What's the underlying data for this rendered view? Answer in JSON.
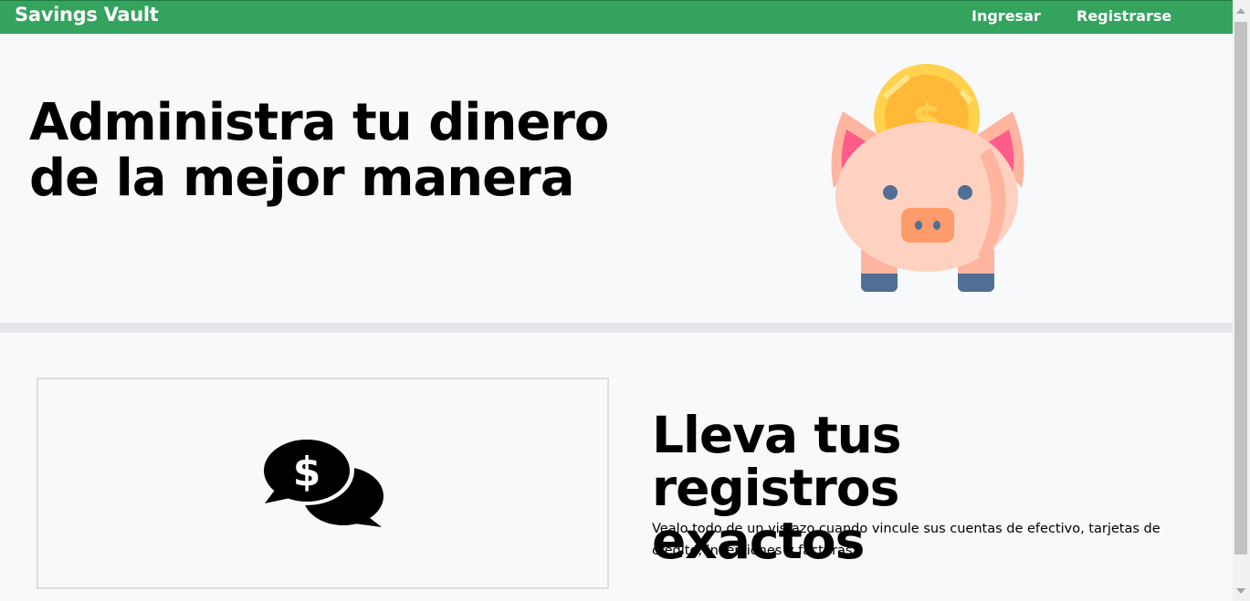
{
  "navbar": {
    "brand": "Savings Vault",
    "login": "Ingresar",
    "register": "Registrarse",
    "color": "#33a35d"
  },
  "hero": {
    "title_line1": "Administra tu dinero",
    "title_line2": "de la mejor manera",
    "image_icon": "piggy-bank-coin-icon"
  },
  "feature": {
    "icon": "chat-money-icon",
    "title_line1": "Lleva tus registros",
    "title_line2": "exactos",
    "description": "Vealo todo de un vistazo cuando vincule sus cuentas de efectivo, tarjetas de credito, inversiones y facturas"
  }
}
